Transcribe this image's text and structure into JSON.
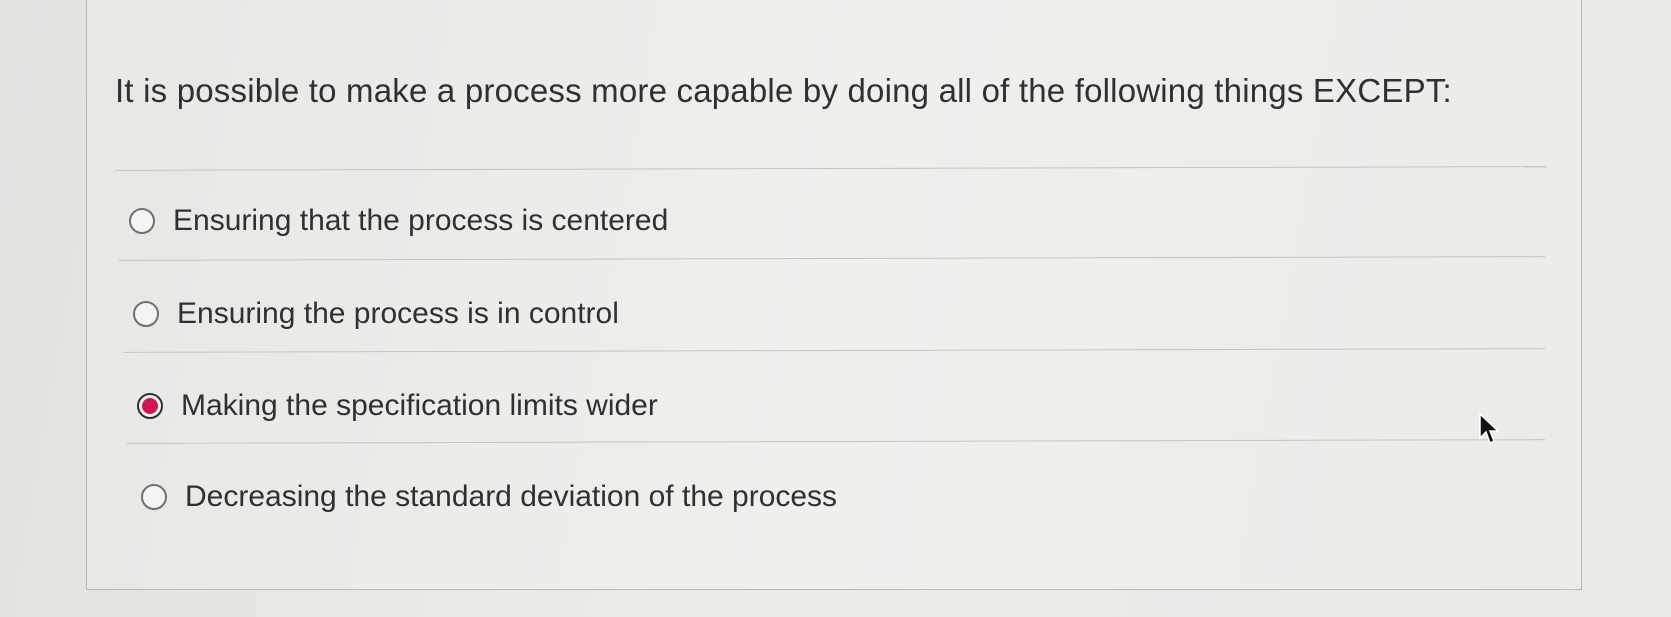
{
  "question": {
    "text": "It is possible to make a process more capable by doing all of the following things EXCEPT:"
  },
  "options": [
    {
      "label": "Ensuring that the process is centered",
      "selected": false
    },
    {
      "label": "Ensuring the process is in control",
      "selected": false
    },
    {
      "label": "Making the specification limits wider",
      "selected": true
    },
    {
      "label": "Decreasing the standard deviation of the process",
      "selected": false
    }
  ],
  "colors": {
    "selected_radio": "#cf1558",
    "text": "#2f3033"
  },
  "icons": {
    "cursor": "mouse-pointer-icon"
  }
}
